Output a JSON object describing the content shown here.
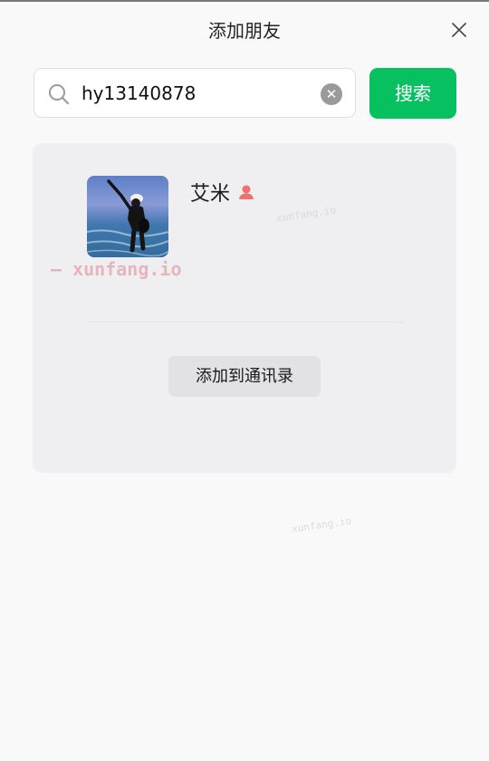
{
  "window": {
    "title": "添加朋友",
    "close_icon": "close-icon"
  },
  "search": {
    "value": "hy13140878",
    "placeholder": "",
    "button_label": "搜索",
    "clear_icon": "clear-icon",
    "search_icon": "search-icon"
  },
  "result": {
    "name": "艾米",
    "gender_icon": "female-icon",
    "avatar": "profile-photo",
    "add_button_label": "添加到通讯录"
  },
  "watermarks": {
    "main": "— xunfang.io",
    "small1": "xunfang.io",
    "small2": "xunfang.io"
  },
  "colors": {
    "accent": "#07c160",
    "background": "#f9f9f9",
    "card": "#efeff2",
    "female_icon": "#f07070"
  }
}
